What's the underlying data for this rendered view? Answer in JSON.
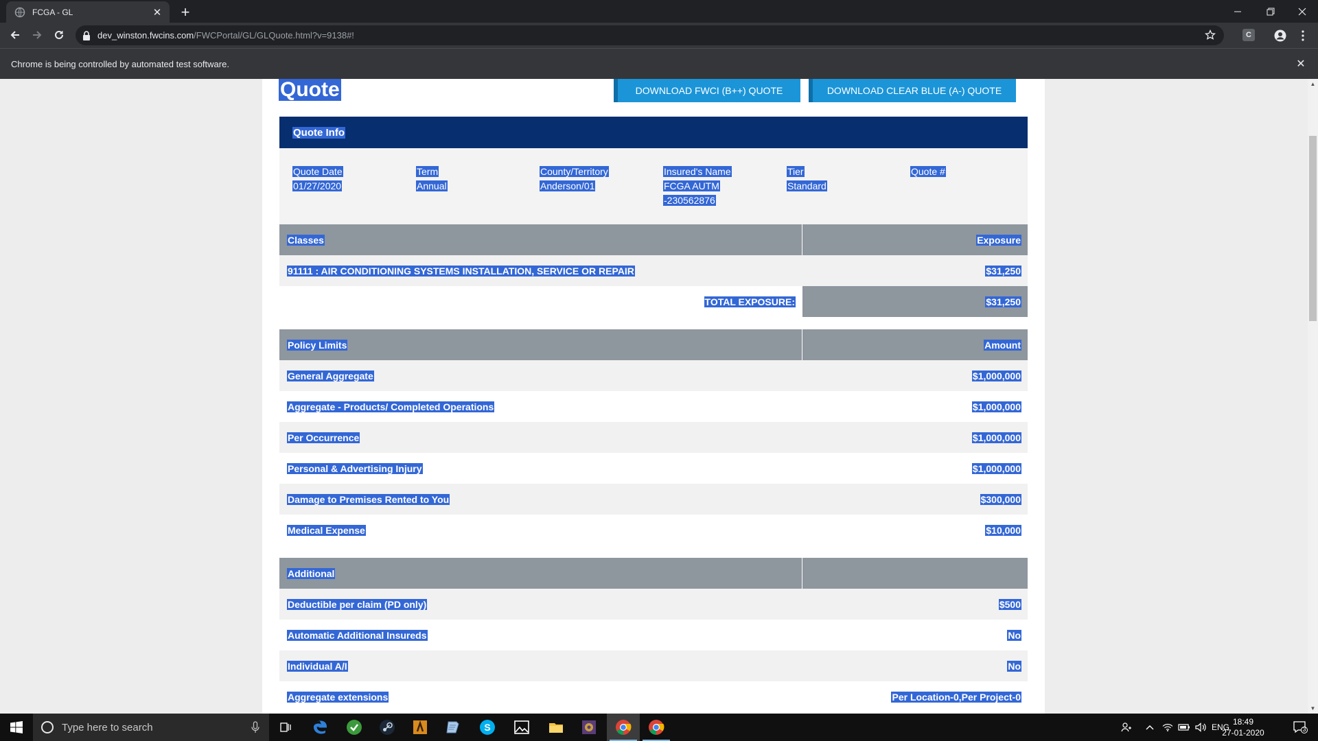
{
  "browser": {
    "tab_title": "FCGA - GL",
    "url_host": "dev_winston.fwcins.com",
    "url_path": "/FWCPortal/GL/GLQuote.html?v=9138#!",
    "infobar_text": "Chrome is being controlled by automated test software.",
    "profile_letter": "C"
  },
  "page": {
    "title": "Quote",
    "download_fwci": "DOWNLOAD FWCI (B++) QUOTE",
    "download_clearblue": "DOWNLOAD CLEAR BLUE (A-) QUOTE"
  },
  "quote_info": {
    "header": "Quote Info",
    "fields": [
      {
        "label": "Quote Date",
        "value_lines": [
          "01/27/2020"
        ]
      },
      {
        "label": "Term",
        "value_lines": [
          "Annual"
        ]
      },
      {
        "label": "County/Territory",
        "value_lines": [
          "Anderson/01"
        ]
      },
      {
        "label": "Insured's Name",
        "value_lines": [
          "FCGA AUTM",
          "-230562876"
        ]
      },
      {
        "label": "Tier",
        "value_lines": [
          "Standard"
        ]
      },
      {
        "label": "Quote #",
        "value_lines": []
      }
    ]
  },
  "classes": {
    "header_left": "Classes",
    "header_right": "Exposure",
    "rows": [
      {
        "label": "91111 : AIR CONDITIONING SYSTEMS INSTALLATION, SERVICE OR REPAIR",
        "value": "$31,250"
      }
    ],
    "total_label": "TOTAL EXPOSURE:",
    "total_value": "$31,250"
  },
  "policy_limits": {
    "header_left": "Policy Limits",
    "header_right": "Amount",
    "rows": [
      {
        "label": "General Aggregate",
        "value": "$1,000,000"
      },
      {
        "label": "Aggregate - Products/ Completed Operations",
        "value": "$1,000,000"
      },
      {
        "label": "Per Occurrence",
        "value": "$1,000,000"
      },
      {
        "label": "Personal & Advertising Injury",
        "value": "$1,000,000"
      },
      {
        "label": "Damage to Premises Rented to You",
        "value": "$300,000"
      },
      {
        "label": "Medical Expense",
        "value": "$10,000"
      }
    ]
  },
  "additional": {
    "header_left": "Additional",
    "header_right": "",
    "rows": [
      {
        "label": "Deductible per claim (PD only)",
        "value": "$500"
      },
      {
        "label": "Automatic Additional Insureds",
        "value": "No"
      },
      {
        "label": "Individual A/I",
        "value": "No"
      },
      {
        "label": "Aggregate extensions",
        "value": "Per Location-0,Per Project-0"
      }
    ]
  },
  "taskbar": {
    "search_placeholder": "Type here to search",
    "language": "ENG",
    "time": "18:49",
    "date": "27-01-2020",
    "notification_count": "3"
  },
  "colors": {
    "selection": "#3367d6",
    "quote_info_header": "#072e6e",
    "table_header": "#8e969e",
    "download_button": "#1b95d8"
  }
}
